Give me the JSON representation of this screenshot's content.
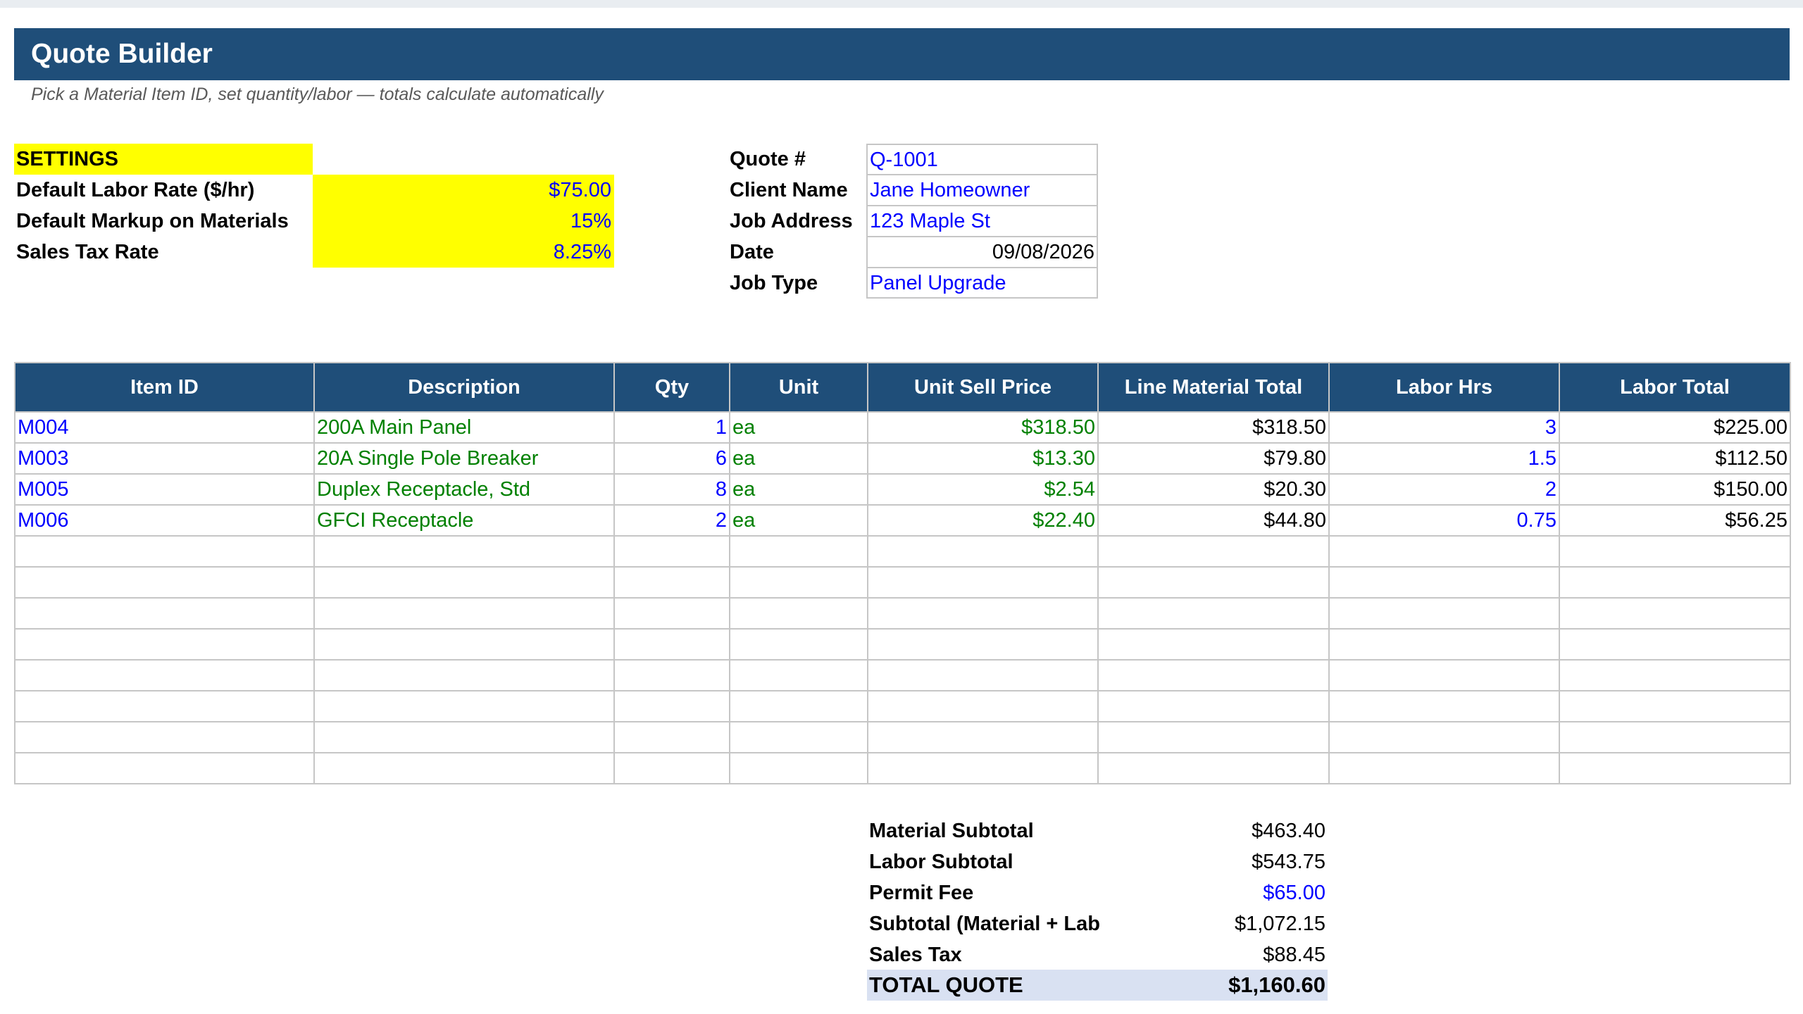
{
  "header": {
    "title": "Quote Builder",
    "subtitle": "Pick a Material Item ID, set quantity/labor — totals calculate automatically"
  },
  "settings": {
    "heading": "SETTINGS",
    "rows": [
      {
        "label": "Default Labor Rate ($/hr)",
        "value": "$75.00"
      },
      {
        "label": "Default Markup on Materials",
        "value": "15%"
      },
      {
        "label": "Sales Tax Rate",
        "value": "8.25%"
      }
    ]
  },
  "quote_info": {
    "rows": [
      {
        "label": "Quote #",
        "value": "Q-1001"
      },
      {
        "label": "Client Name",
        "value": "Jane Homeowner"
      },
      {
        "label": "Job Address",
        "value": "123 Maple St"
      },
      {
        "label": "Date",
        "value": "09/08/2026"
      },
      {
        "label": "Job Type",
        "value": "Panel Upgrade"
      }
    ]
  },
  "items_table": {
    "columns": [
      "Item ID",
      "Description",
      "Qty",
      "Unit",
      "Unit Sell Price",
      "Line Material Total",
      "Labor Hrs",
      "Labor Total"
    ],
    "rows": [
      [
        "M004",
        "200A Main Panel",
        "1",
        "ea",
        "$318.50",
        "$318.50",
        "3",
        "$225.00"
      ],
      [
        "M003",
        "20A Single Pole Breaker",
        "6",
        "ea",
        "$13.30",
        "$79.80",
        "1.5",
        "$112.50"
      ],
      [
        "M005",
        "Duplex Receptacle, Std",
        "8",
        "ea",
        "$2.54",
        "$20.30",
        "2",
        "$150.00"
      ],
      [
        "M006",
        "GFCI Receptacle",
        "2",
        "ea",
        "$22.40",
        "$44.80",
        "0.75",
        "$56.25"
      ],
      [
        "",
        "",
        "",
        "",
        "",
        "",
        "",
        ""
      ],
      [
        "",
        "",
        "",
        "",
        "",
        "",
        "",
        ""
      ],
      [
        "",
        "",
        "",
        "",
        "",
        "",
        "",
        ""
      ],
      [
        "",
        "",
        "",
        "",
        "",
        "",
        "",
        ""
      ],
      [
        "",
        "",
        "",
        "",
        "",
        "",
        "",
        ""
      ],
      [
        "",
        "",
        "",
        "",
        "",
        "",
        "",
        ""
      ],
      [
        "",
        "",
        "",
        "",
        "",
        "",
        "",
        ""
      ],
      [
        "",
        "",
        "",
        "",
        "",
        "",
        "",
        ""
      ]
    ]
  },
  "summary": {
    "rows": [
      {
        "label": "Material Subtotal",
        "value": "$463.40"
      },
      {
        "label": "Labor Subtotal",
        "value": "$543.75"
      },
      {
        "label": "Permit Fee",
        "value": "$65.00"
      },
      {
        "label": "Subtotal (Material + Labor)",
        "value": "$1,072.15"
      },
      {
        "label": "Sales Tax",
        "value": "$88.45"
      }
    ],
    "total": {
      "label": "TOTAL QUOTE",
      "value": "$1,160.60"
    }
  },
  "colors": {
    "header_bg": "#1f4e79",
    "settings_highlight": "#ffff00",
    "input_text": "#0000ff",
    "lookup_text": "#008000",
    "total_bg": "#d9e1f2"
  }
}
